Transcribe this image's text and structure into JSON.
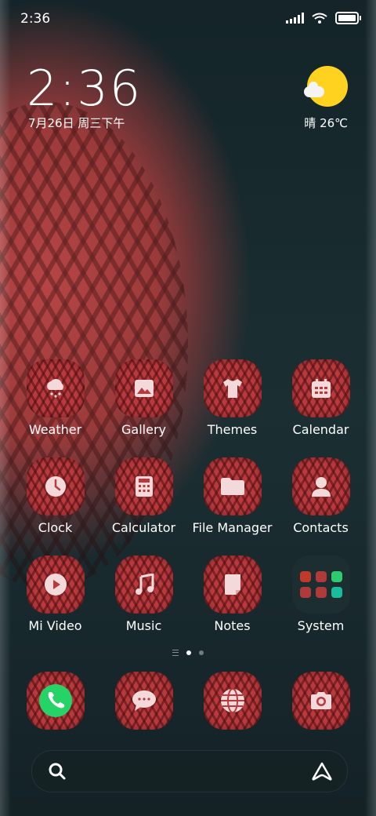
{
  "status_bar": {
    "time": "2:36"
  },
  "lock_clock": {
    "time": "2:36",
    "date": "7月26日 周三下午"
  },
  "weather": {
    "text": "晴 26℃"
  },
  "apps": [
    {
      "label": "Weather",
      "icon": "cloud-snow-icon"
    },
    {
      "label": "Gallery",
      "icon": "image-icon"
    },
    {
      "label": "Themes",
      "icon": "tshirt-icon"
    },
    {
      "label": "Calendar",
      "icon": "calendar-icon"
    },
    {
      "label": "Clock",
      "icon": "clock-icon"
    },
    {
      "label": "Calculator",
      "icon": "calculator-icon"
    },
    {
      "label": "File Manager",
      "icon": "folder-icon"
    },
    {
      "label": "Contacts",
      "icon": "person-icon"
    },
    {
      "label": "Mi Video",
      "icon": "play-icon"
    },
    {
      "label": "Music",
      "icon": "music-note-icon"
    },
    {
      "label": "Notes",
      "icon": "note-icon"
    },
    {
      "label": "System",
      "icon": "folder-group-icon"
    }
  ],
  "dock": [
    {
      "icon": "phone-icon"
    },
    {
      "icon": "message-icon"
    },
    {
      "icon": "globe-icon"
    },
    {
      "icon": "camera-icon"
    }
  ],
  "folder_colors": [
    "#c0392b",
    "#b03a3a",
    "#2ecc71",
    "#7f8c8d",
    "#34495e",
    "#1abc9c"
  ],
  "accent_colors": {
    "icon_red": "#b83a3f",
    "sun_yellow": "#ffd21f"
  }
}
